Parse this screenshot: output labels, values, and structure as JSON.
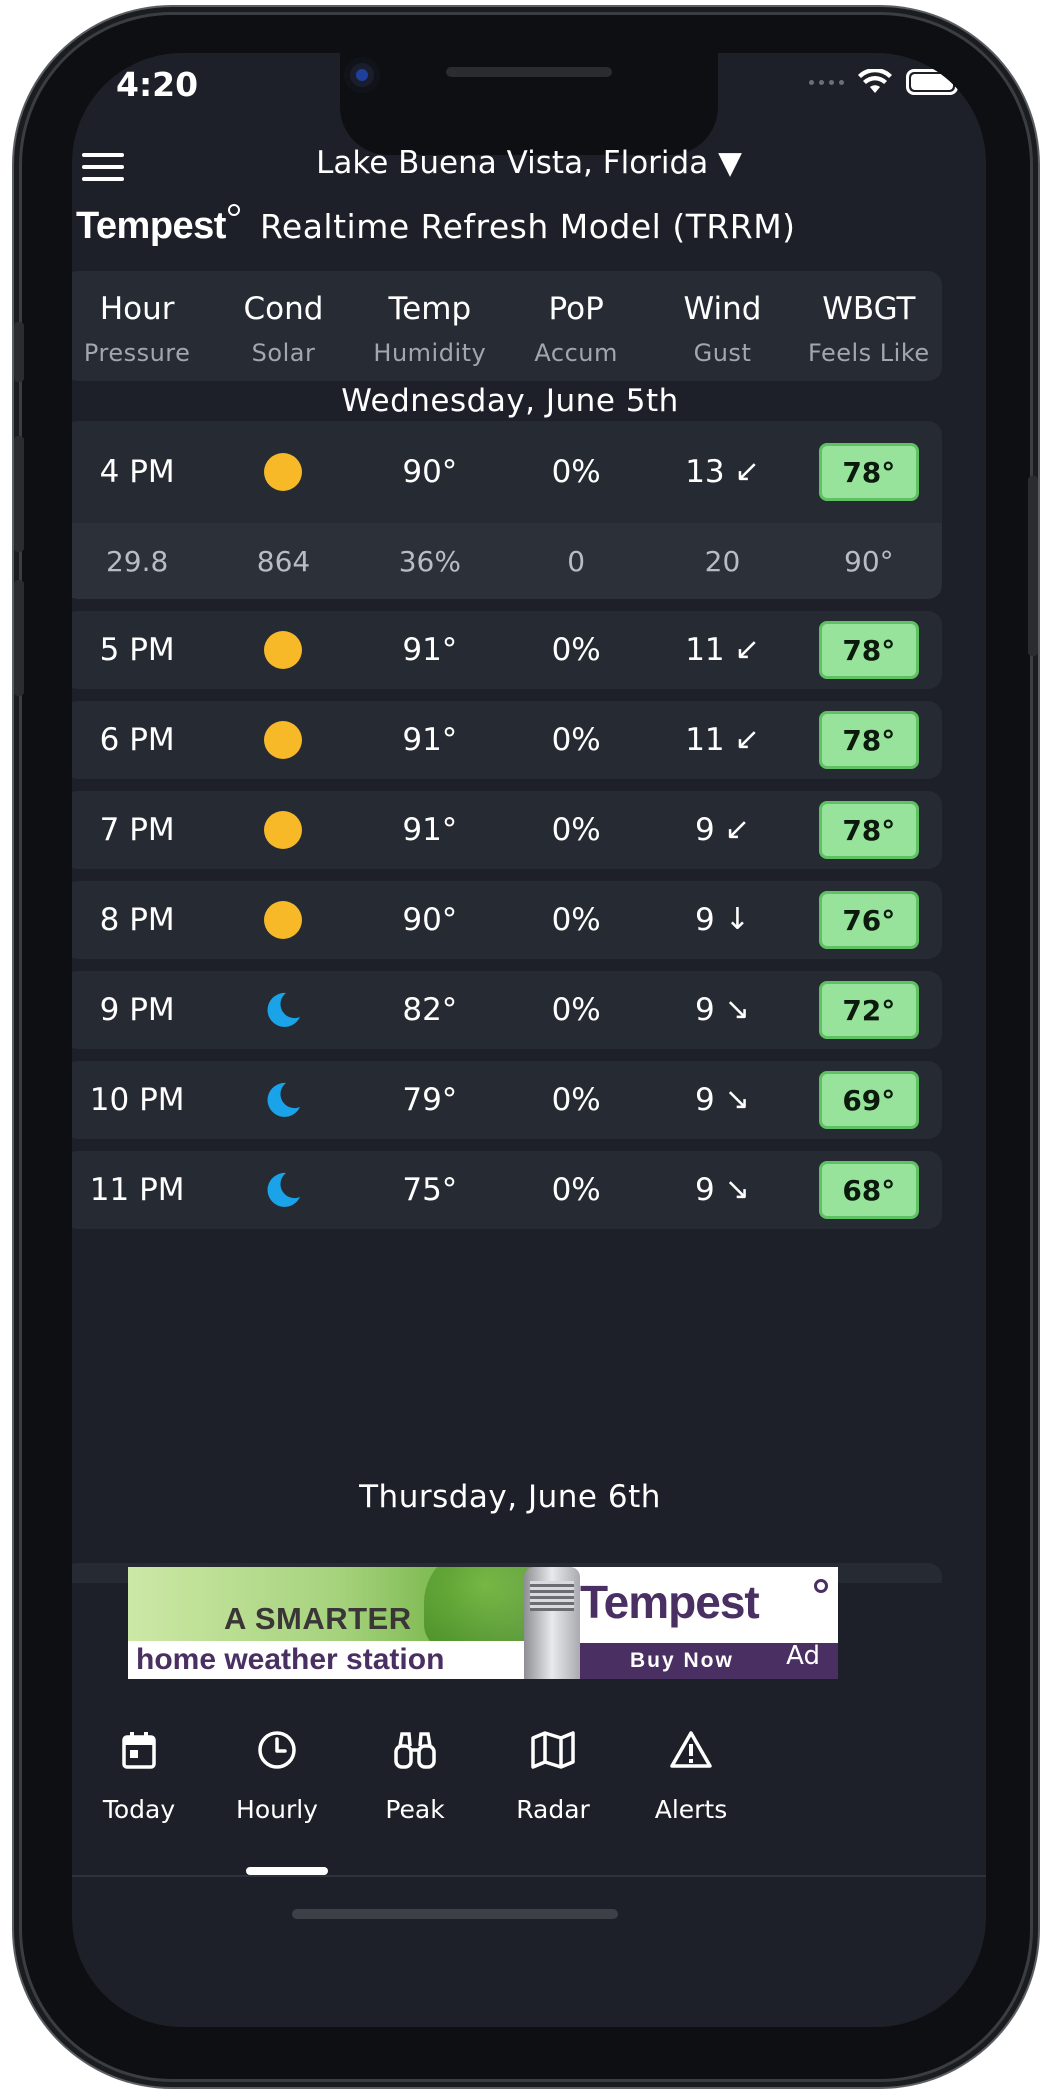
{
  "status_bar": {
    "time": "4:20"
  },
  "header": {
    "location": "Lake Buena Vista, Florida ▼",
    "brand": "Tempest",
    "model": "Realtime Refresh Model (TRRM)"
  },
  "columns": {
    "top": [
      "Hour",
      "Cond",
      "Temp",
      "PoP",
      "Wind",
      "WBGT"
    ],
    "bottom": [
      "Pressure",
      "Solar",
      "Humidity",
      "Accum",
      "Gust",
      "Feels Like"
    ]
  },
  "days": [
    "Wednesday, June 5th",
    "Thursday, June 6th"
  ],
  "hours": [
    {
      "hour": "4 PM",
      "cond": "sun",
      "temp": "90°",
      "pop": "0%",
      "wind": "13",
      "arrow": "↙",
      "wbgt": "78°",
      "details": {
        "pressure": "29.8",
        "solar": "864",
        "humidity": "36%",
        "accum": "0",
        "gust": "20",
        "feels_like": "90°"
      }
    },
    {
      "hour": "5 PM",
      "cond": "sun",
      "temp": "91°",
      "pop": "0%",
      "wind": "11",
      "arrow": "↙",
      "wbgt": "78°"
    },
    {
      "hour": "6 PM",
      "cond": "sun",
      "temp": "91°",
      "pop": "0%",
      "wind": "11",
      "arrow": "↙",
      "wbgt": "78°"
    },
    {
      "hour": "7 PM",
      "cond": "sun",
      "temp": "91°",
      "pop": "0%",
      "wind": "9",
      "arrow": "↙",
      "wbgt": "78°"
    },
    {
      "hour": "8 PM",
      "cond": "sun",
      "temp": "90°",
      "pop": "0%",
      "wind": "9",
      "arrow": "↓",
      "wbgt": "76°"
    },
    {
      "hour": "9 PM",
      "cond": "moon",
      "temp": "82°",
      "pop": "0%",
      "wind": "9",
      "arrow": "↘",
      "wbgt": "72°"
    },
    {
      "hour": "10 PM",
      "cond": "moon",
      "temp": "79°",
      "pop": "0%",
      "wind": "9",
      "arrow": "↘",
      "wbgt": "69°"
    },
    {
      "hour": "11 PM",
      "cond": "moon",
      "temp": "75°",
      "pop": "0%",
      "wind": "9",
      "arrow": "↘",
      "wbgt": "68°"
    }
  ],
  "ad": {
    "line1": "A SMARTER",
    "line2": "home weather station",
    "brand": "Tempest",
    "cta": "Buy Now",
    "tag": "Ad"
  },
  "tabs": [
    {
      "label": "Today",
      "icon": "calendar-icon"
    },
    {
      "label": "Hourly",
      "icon": "clock-icon",
      "selected": true
    },
    {
      "label": "Peak",
      "icon": "binoculars-icon"
    },
    {
      "label": "Radar",
      "icon": "map-icon"
    },
    {
      "label": "Alerts",
      "icon": "warning-icon"
    }
  ],
  "colors": {
    "background": "#1d2028",
    "card": "#262a32",
    "sun": "#f7b928",
    "moon": "#1aa3e8",
    "wbgt_fill": "#97e39b",
    "wbgt_border": "#5ec262"
  }
}
